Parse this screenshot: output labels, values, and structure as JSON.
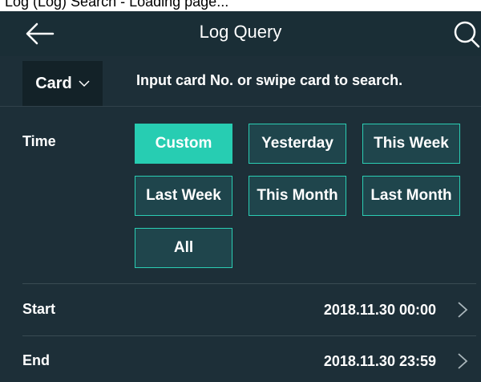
{
  "caption_fragment": "Log (Log) Search - Loading page...",
  "header": {
    "title": "Log Query"
  },
  "filter": {
    "type_label": "Card",
    "hint": "Input card No. or swipe card to search."
  },
  "time": {
    "label": "Time",
    "options": [
      "Custom",
      "Yesterday",
      "This Week",
      "Last Week",
      "This Month",
      "Last Month",
      "All"
    ],
    "selected": "Custom"
  },
  "start": {
    "label": "Start",
    "value": "2018.11.30  00:00"
  },
  "end": {
    "label": "End",
    "value": "2018.11.30  23:59"
  },
  "colors": {
    "accent": "#27cdb2",
    "background": "#1d2f38",
    "chip": "#1f454c"
  },
  "icons": {
    "back": "back-arrow-icon",
    "search": "search-icon",
    "dropdown": "chevron-down-icon",
    "row": "chevron-right-icon"
  }
}
